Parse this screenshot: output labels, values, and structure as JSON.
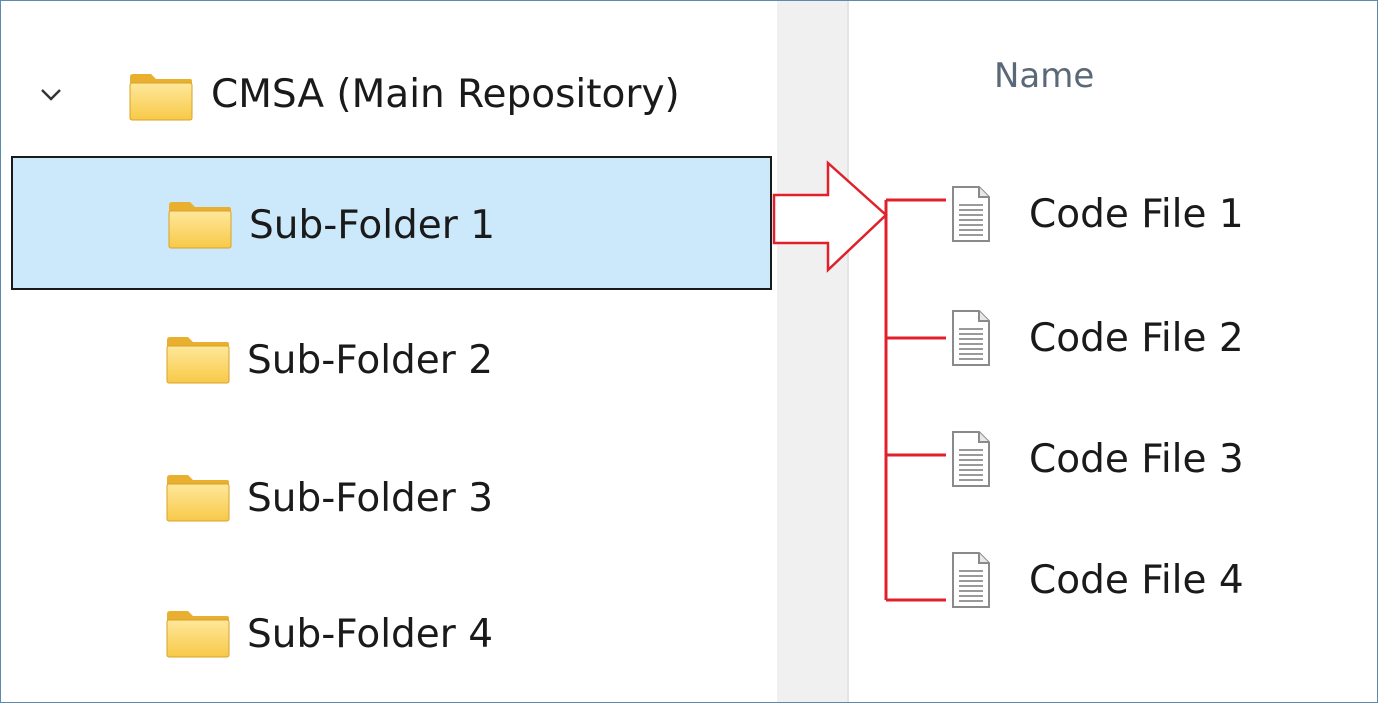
{
  "tree": {
    "root": {
      "label": "CMSA (Main Repository)",
      "expand_icon": "chevron-down-icon",
      "icon": "folder-icon"
    },
    "items": [
      {
        "label": "Sub-Folder 1",
        "icon": "folder-icon",
        "selected": true
      },
      {
        "label": "Sub-Folder 2",
        "icon": "folder-icon",
        "selected": false
      },
      {
        "label": "Sub-Folder 3",
        "icon": "folder-icon",
        "selected": false
      },
      {
        "label": "Sub-Folder 4",
        "icon": "folder-icon",
        "selected": false
      }
    ]
  },
  "content": {
    "column_header": "Name",
    "files": [
      {
        "label": "Code File 1",
        "icon": "document-icon"
      },
      {
        "label": "Code File 2",
        "icon": "document-icon"
      },
      {
        "label": "Code File 3",
        "icon": "document-icon"
      },
      {
        "label": "Code File 4",
        "icon": "document-icon"
      }
    ]
  },
  "annotation": {
    "color": "#e0202a"
  },
  "colors": {
    "selection_background": "#cce8fb",
    "window_border": "#5b8bb0",
    "splitter": "#f0f0f0"
  }
}
